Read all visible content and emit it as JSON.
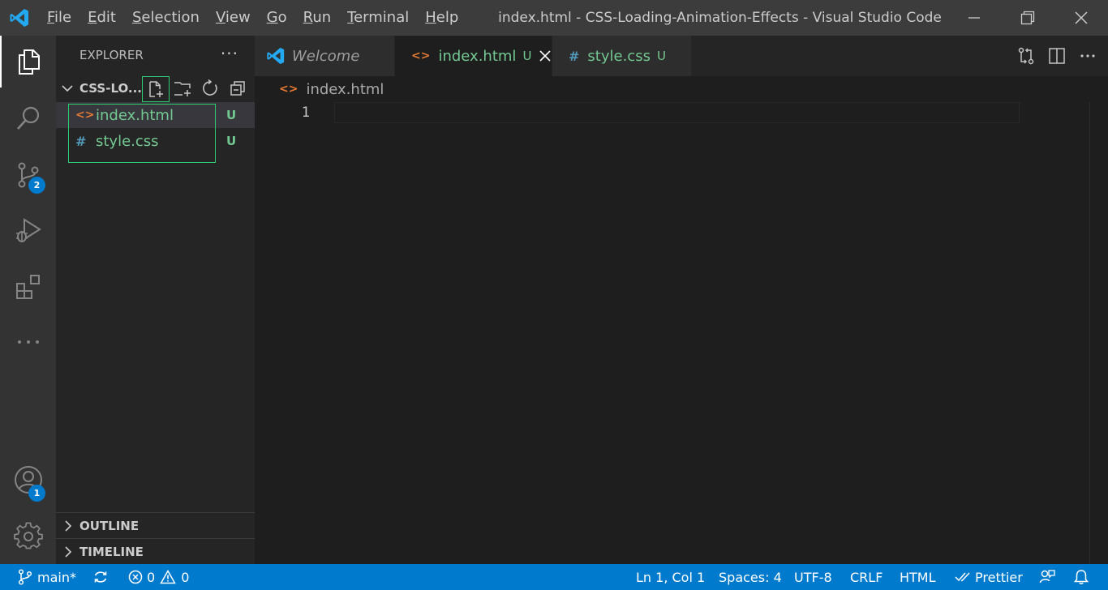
{
  "titlebar": {
    "window_title": "index.html - CSS-Loading-Animation-Effects - Visual Studio Code",
    "menu": [
      {
        "mnemonic": "F",
        "rest": "ile"
      },
      {
        "mnemonic": "E",
        "rest": "dit"
      },
      {
        "mnemonic": "S",
        "rest": "election"
      },
      {
        "mnemonic": "V",
        "rest": "iew"
      },
      {
        "mnemonic": "G",
        "rest": "o"
      },
      {
        "mnemonic": "R",
        "rest": "un"
      },
      {
        "mnemonic": "T",
        "rest": "erminal"
      },
      {
        "mnemonic": "H",
        "rest": "elp"
      }
    ]
  },
  "activity_bar": {
    "items": [
      "explorer-icon",
      "search-icon",
      "source-control-icon",
      "run-debug-icon",
      "extensions-icon",
      "more-icon"
    ],
    "source_control_badge": "2",
    "accounts_badge": "1"
  },
  "sidebar": {
    "title": "EXPLORER",
    "more": "···",
    "folder": "CSS-LO...",
    "files": [
      {
        "name": "index.html",
        "icon": "<>",
        "status": "U"
      },
      {
        "name": "style.css",
        "icon": "#",
        "status": "U"
      }
    ],
    "panels": [
      "OUTLINE",
      "TIMELINE"
    ]
  },
  "tabs": [
    {
      "label": "Welcome",
      "status": ""
    },
    {
      "label": "index.html",
      "status": "U"
    },
    {
      "label": "style.css",
      "status": "U"
    }
  ],
  "breadcrumb": {
    "file": "index.html"
  },
  "editor": {
    "line_numbers": [
      "1"
    ]
  },
  "statusbar": {
    "branch": "main*",
    "errors": "0",
    "warnings": "0",
    "position": "Ln 1, Col 1",
    "spaces": "Spaces: 4",
    "encoding": "UTF-8",
    "eol": "CRLF",
    "language": "HTML",
    "formatter": "Prettier"
  },
  "colors": {
    "accent": "#007acc",
    "untracked": "#73c991",
    "html_icon": "#e37933",
    "css_icon": "#519aba",
    "highlight_outline": "#2ecc71"
  }
}
